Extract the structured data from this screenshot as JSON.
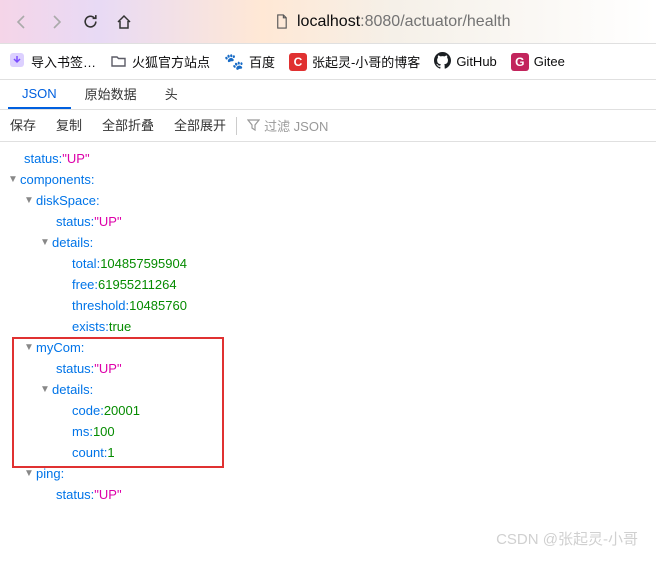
{
  "url": {
    "host": "localhost",
    "port": ":8080",
    "path": "/actuator/health"
  },
  "bookmarks": {
    "import": "导入书签…",
    "firefox": "火狐官方站点",
    "baidu": "百度",
    "blog": "张起灵-小哥的博客",
    "github": "GitHub",
    "gitee": "Gitee"
  },
  "tabs": {
    "json": "JSON",
    "raw": "原始数据",
    "headers": "头"
  },
  "toolbar": {
    "save": "保存",
    "copy": "复制",
    "collapse": "全部折叠",
    "expand": "全部展开",
    "filter": "过滤 JSON"
  },
  "json_labels": {
    "status": "status:",
    "components": "components:",
    "diskSpace": "diskSpace:",
    "details": "details:",
    "total": "total:",
    "free": "free:",
    "threshold": "threshold:",
    "exists": "exists:",
    "myCom": "myCom:",
    "code": "code:",
    "ms": "ms:",
    "count": "count:",
    "ping": "ping:"
  },
  "json_values": {
    "status_up": "\"UP\"",
    "disk_status": "\"UP\"",
    "disk_total": "104857595904",
    "disk_free": "61955211264",
    "disk_threshold": "10485760",
    "disk_exists": "true",
    "mycom_status": "\"UP\"",
    "mycom_code": "20001",
    "mycom_ms": "100",
    "mycom_count": "1",
    "ping_status": "\"UP\""
  },
  "watermark": "CSDN @张起灵-小哥"
}
